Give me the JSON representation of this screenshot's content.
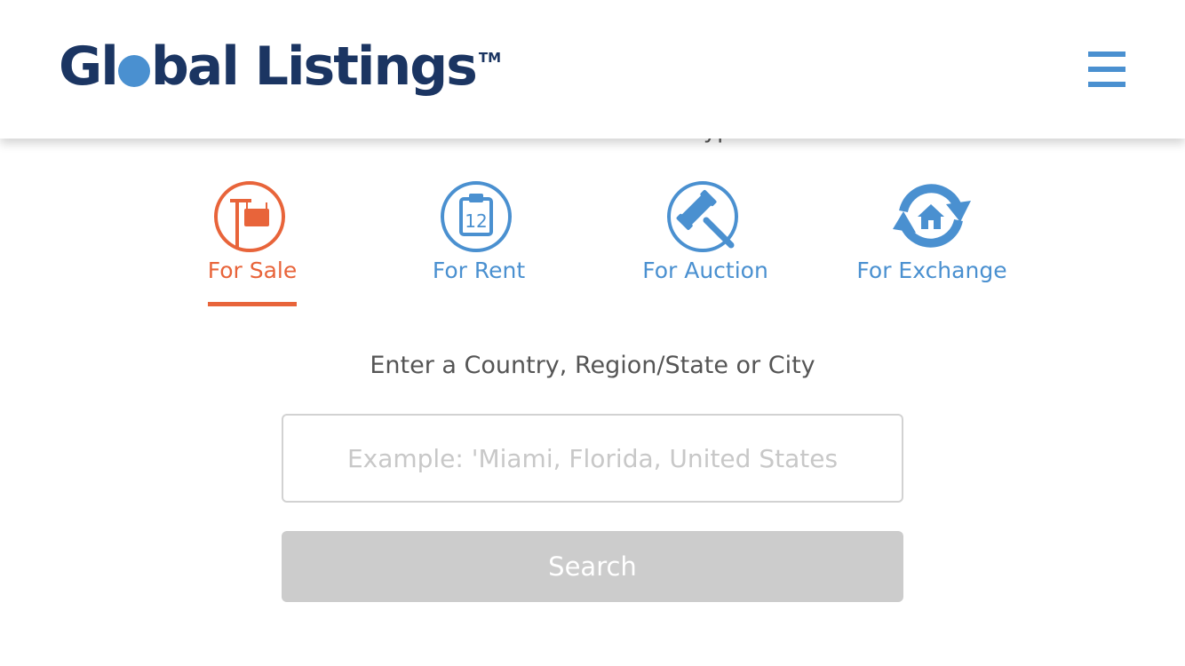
{
  "header": {
    "logo": {
      "part1": "Gl",
      "part2": "bal Listings",
      "trademark": "TM"
    },
    "menu_icon": "hamburger-menu-icon"
  },
  "transaction": {
    "heading": "Choose a Transaction Type",
    "options": [
      {
        "label": "For Sale",
        "icon": "for-sale-sign-icon",
        "active": true
      },
      {
        "label": "For Rent",
        "icon": "calendar-12-icon",
        "active": false
      },
      {
        "label": "For Auction",
        "icon": "gavel-icon",
        "active": false
      },
      {
        "label": "For Exchange",
        "icon": "house-exchange-icon",
        "active": false
      }
    ]
  },
  "search": {
    "prompt": "Enter a Country, Region/State or City",
    "placeholder": "Example: 'Miami, Florida, United States",
    "value": "",
    "button_label": "Search"
  },
  "colors": {
    "brand_navy": "#1b3562",
    "accent_blue": "#4a90d0",
    "accent_orange": "#e8643a",
    "disabled_gray": "#cccccc"
  }
}
